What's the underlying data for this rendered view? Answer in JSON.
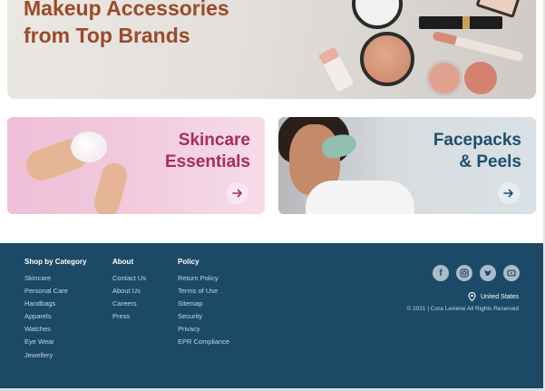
{
  "hero": {
    "title_line1": "Makeup Accessories",
    "title_line2": "from Top Brands"
  },
  "promos": [
    {
      "title_line1": "Skincare",
      "title_line2": "Essentials",
      "arrow_icon": "arrow-right-icon"
    },
    {
      "title_line1": "Facepacks",
      "title_line2": "& Peels",
      "arrow_icon": "arrow-right-icon"
    }
  ],
  "footer": {
    "columns": [
      {
        "heading": "Shop by Category",
        "links": [
          "Skincare",
          "Personal Care",
          "Handbags",
          "Apparels",
          "Watches",
          "Eye Wear",
          "Jewellery"
        ]
      },
      {
        "heading": "About",
        "links": [
          "Contact Us",
          "About Us",
          "Careers",
          "Press"
        ]
      },
      {
        "heading": "Policy",
        "links": [
          "Return Policy",
          "Terms of Use",
          "Sitemap",
          "Security",
          "Privacy",
          "EPR Compliance"
        ]
      }
    ],
    "socials": [
      "facebook-icon",
      "instagram-icon",
      "twitter-icon",
      "youtube-icon"
    ],
    "country": "United States",
    "copyright": "© 2021 | Cora Leviene All Rights Reserved"
  },
  "colors": {
    "footer_bg": "#1c4966",
    "hero_title": "#9a4a2a",
    "skincare_accent": "#a82d58",
    "facepacks_accent": "#1e4f6c"
  }
}
